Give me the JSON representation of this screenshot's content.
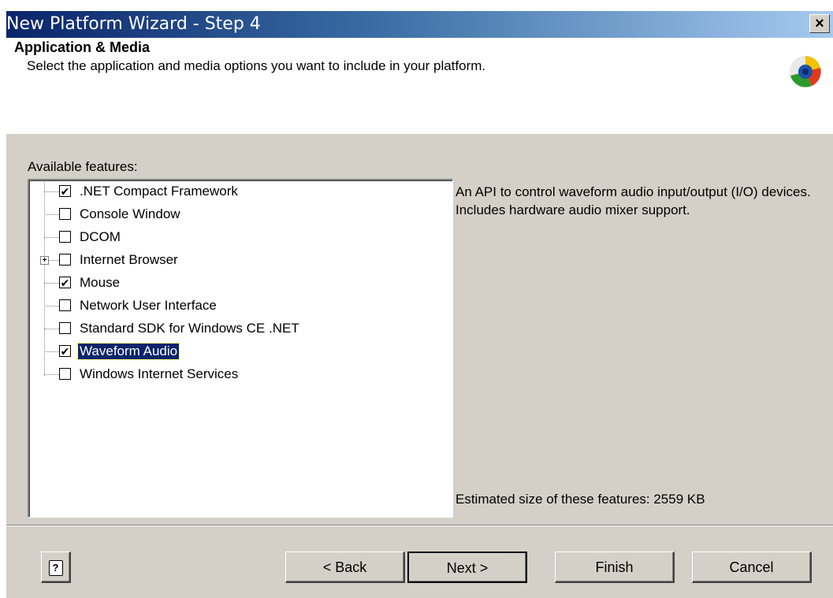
{
  "window": {
    "title": "New Platform Wizard - Step 4",
    "close_symbol": "×"
  },
  "header": {
    "title": "Application & Media",
    "subtitle": "Select the application and media options you want to include in your platform.",
    "logo_icon": "windows-ce-logo-icon"
  },
  "features": {
    "label": "Available features:",
    "items": [
      {
        "label": ".NET Compact Framework",
        "checked": true
      },
      {
        "label": "Console Window",
        "checked": false
      },
      {
        "label": "DCOM",
        "checked": false
      },
      {
        "label": "Internet Browser",
        "checked": false,
        "expandable": true,
        "expander": "+"
      },
      {
        "label": "Mouse",
        "checked": true
      },
      {
        "label": "Network User Interface",
        "checked": false
      },
      {
        "label": "Standard SDK for Windows CE .NET",
        "checked": false
      },
      {
        "label": "Waveform Audio",
        "checked": true,
        "selected": true
      },
      {
        "label": "Windows Internet Services",
        "checked": false
      }
    ],
    "check_mark": "✔"
  },
  "description": "An API to control waveform audio input/output (I/O) devices. Includes hardware audio mixer support.",
  "size_text": "Estimated size of these features: 2559 KB",
  "buttons": {
    "help": "?",
    "back": "< Back",
    "next": "Next >",
    "finish": "Finish",
    "cancel": "Cancel"
  },
  "colors": {
    "selection": "#0a246a",
    "dialog_face": "#d4d0c8",
    "title_start": "#0a246a",
    "title_end": "#a6caf0"
  }
}
